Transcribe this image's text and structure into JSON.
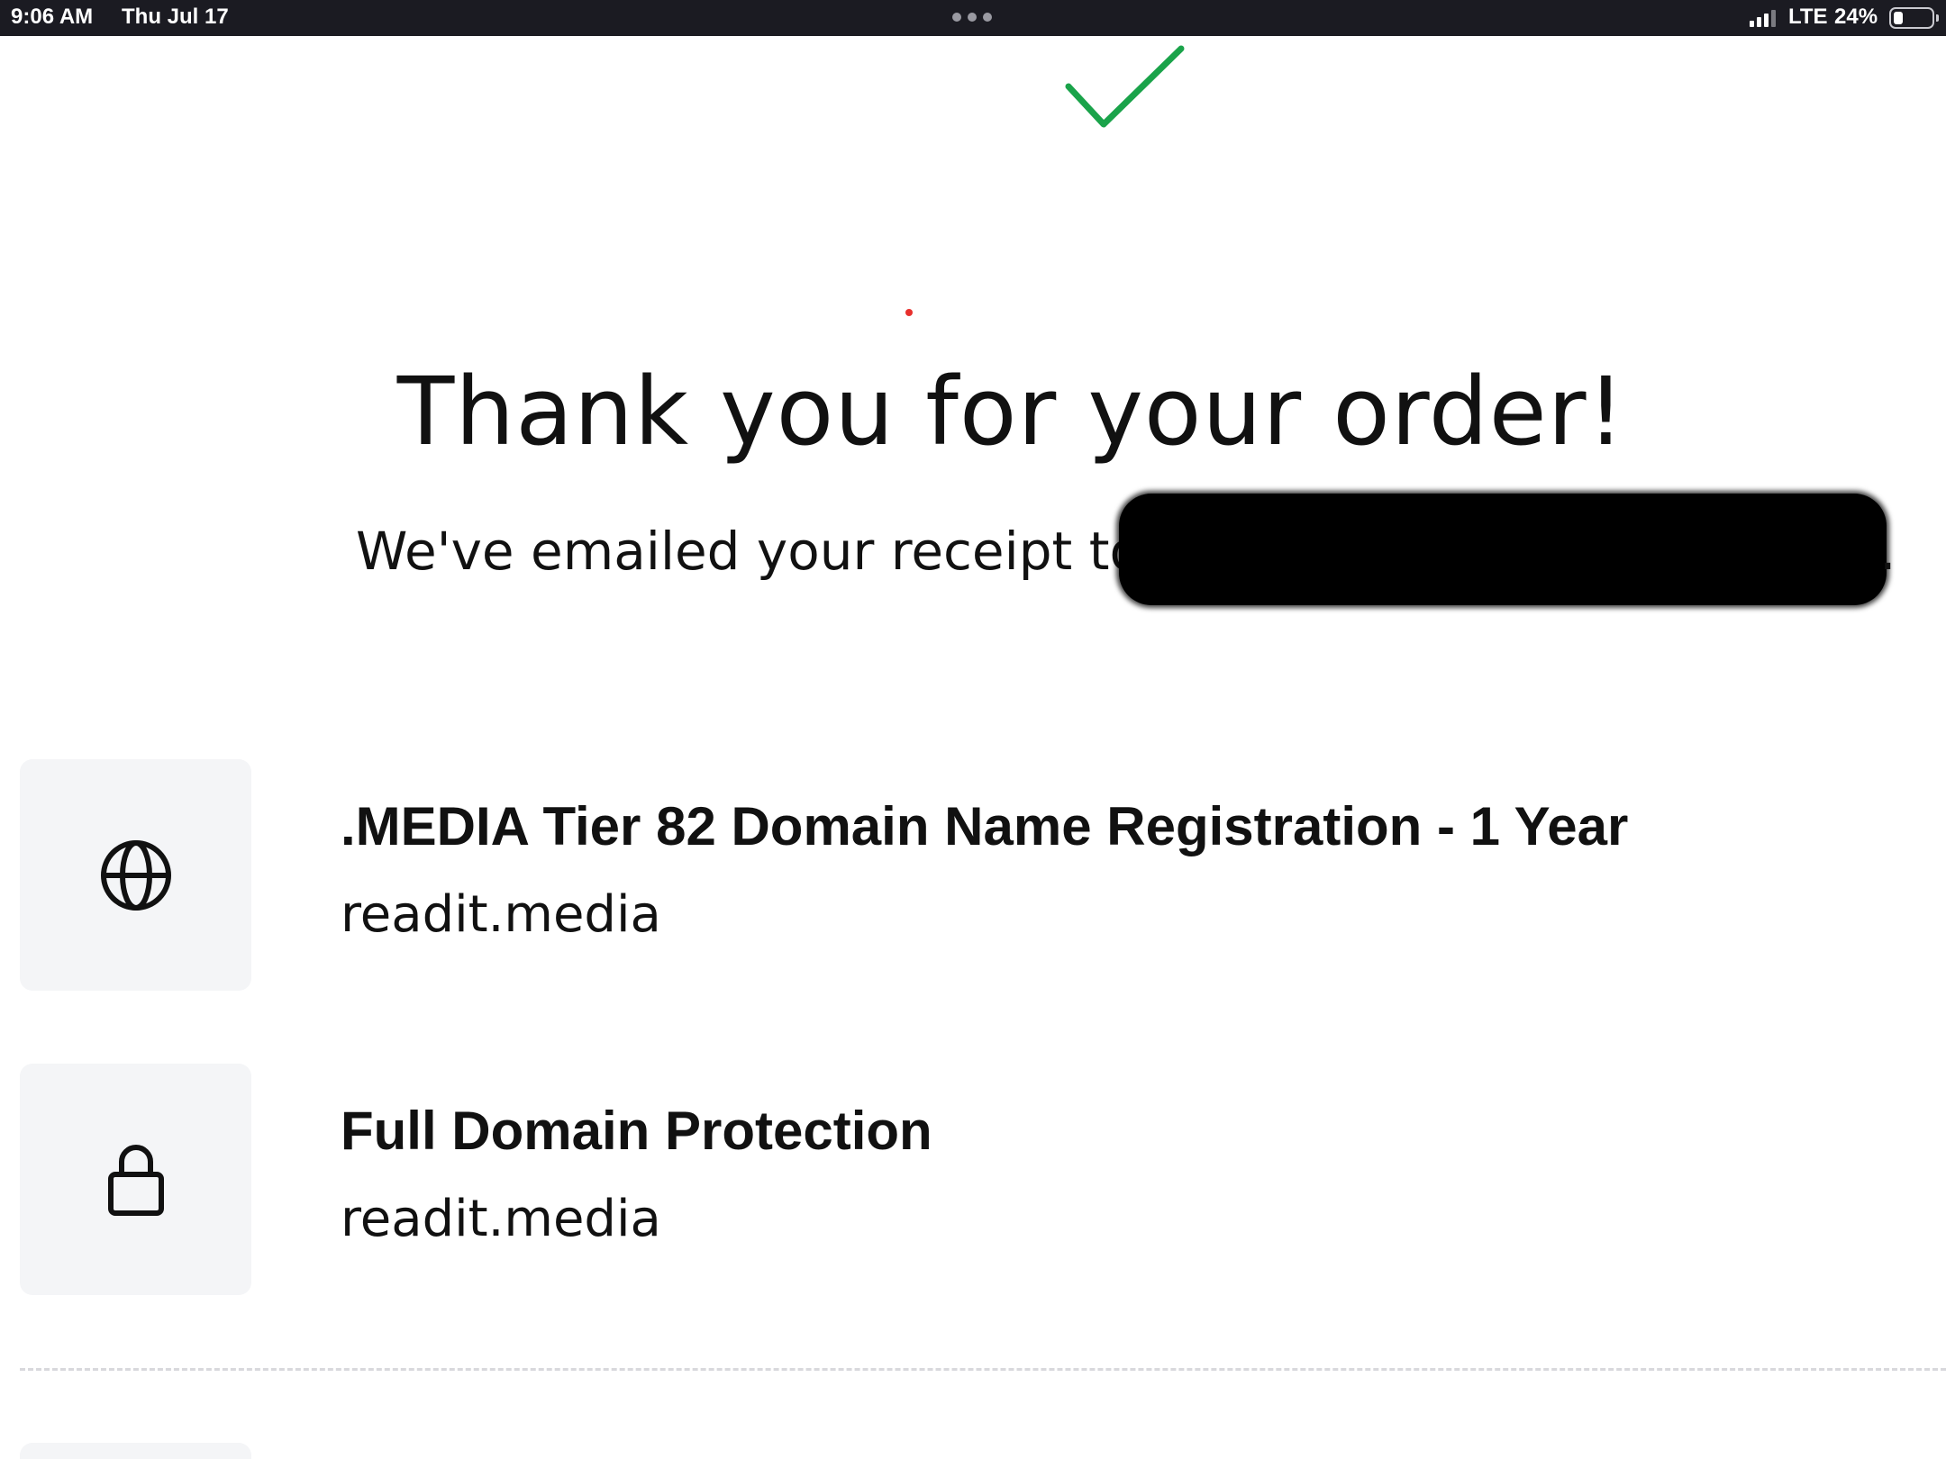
{
  "status_bar": {
    "time": "9:06 AM",
    "date": "Thu Jul 17",
    "network": "LTE",
    "battery_percent_label": "24%",
    "battery_level": 0.24
  },
  "confirmation": {
    "title": "Thank you for your order!",
    "receipt_text": "We've emailed your receipt to",
    "receipt_end": ".",
    "check_color": "#1aa34a"
  },
  "items": [
    {
      "icon": "globe-icon",
      "name": ".MEDIA Tier 82 Domain Name Registration - 1 Year",
      "domain": "readit.media"
    },
    {
      "icon": "lock-icon",
      "name": "Full Domain Protection",
      "domain": "readit.media"
    }
  ]
}
